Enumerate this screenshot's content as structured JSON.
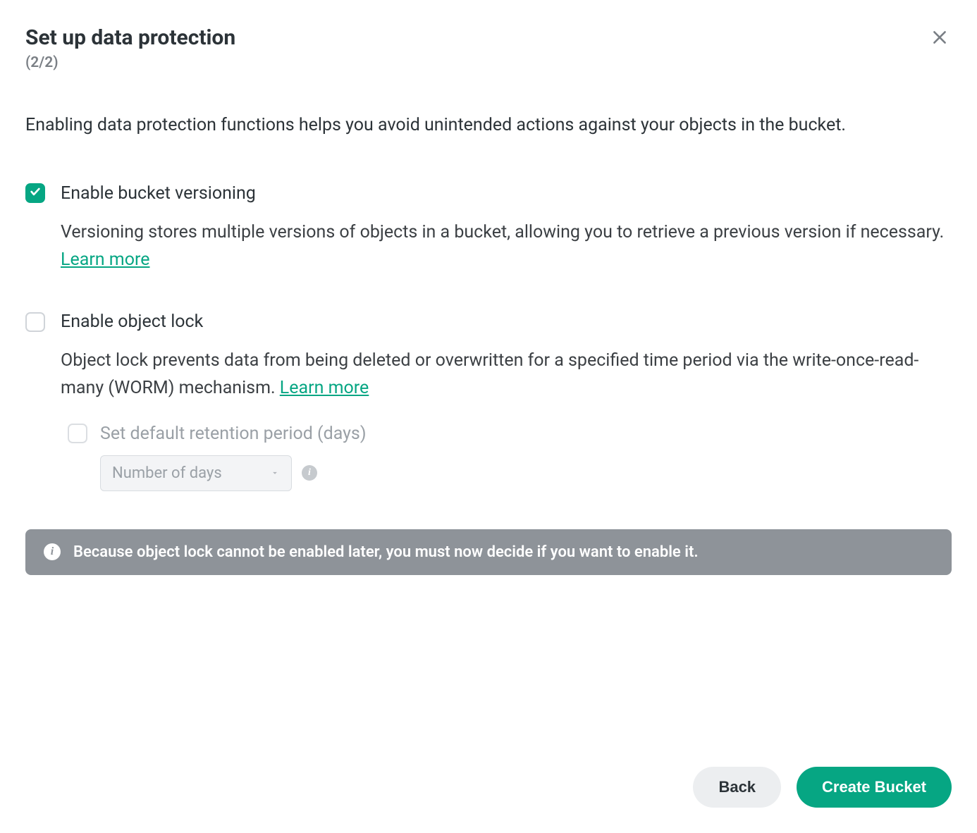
{
  "header": {
    "title": "Set up data protection",
    "step": "(2/2)"
  },
  "intro": "Enabling data protection functions helps you avoid unintended actions against your objects in the bucket.",
  "options": {
    "versioning": {
      "label": "Enable bucket versioning",
      "checked": true,
      "description": "Versioning stores multiple versions of objects in a bucket, allowing you to retrieve a previous version if necessary. ",
      "learn_more": "Learn more"
    },
    "object_lock": {
      "label": "Enable object lock",
      "checked": false,
      "description": "Object lock prevents data from being deleted or overwritten for a specified time period via the write-once-read-many (WORM) mechanism. ",
      "learn_more": "Learn more",
      "retention": {
        "label": "Set default retention period (days)",
        "placeholder": "Number of days",
        "enabled": false
      }
    }
  },
  "notice": "Because object lock cannot be enabled later, you must now decide if you want to enable it.",
  "footer": {
    "back": "Back",
    "create": "Create Bucket"
  }
}
